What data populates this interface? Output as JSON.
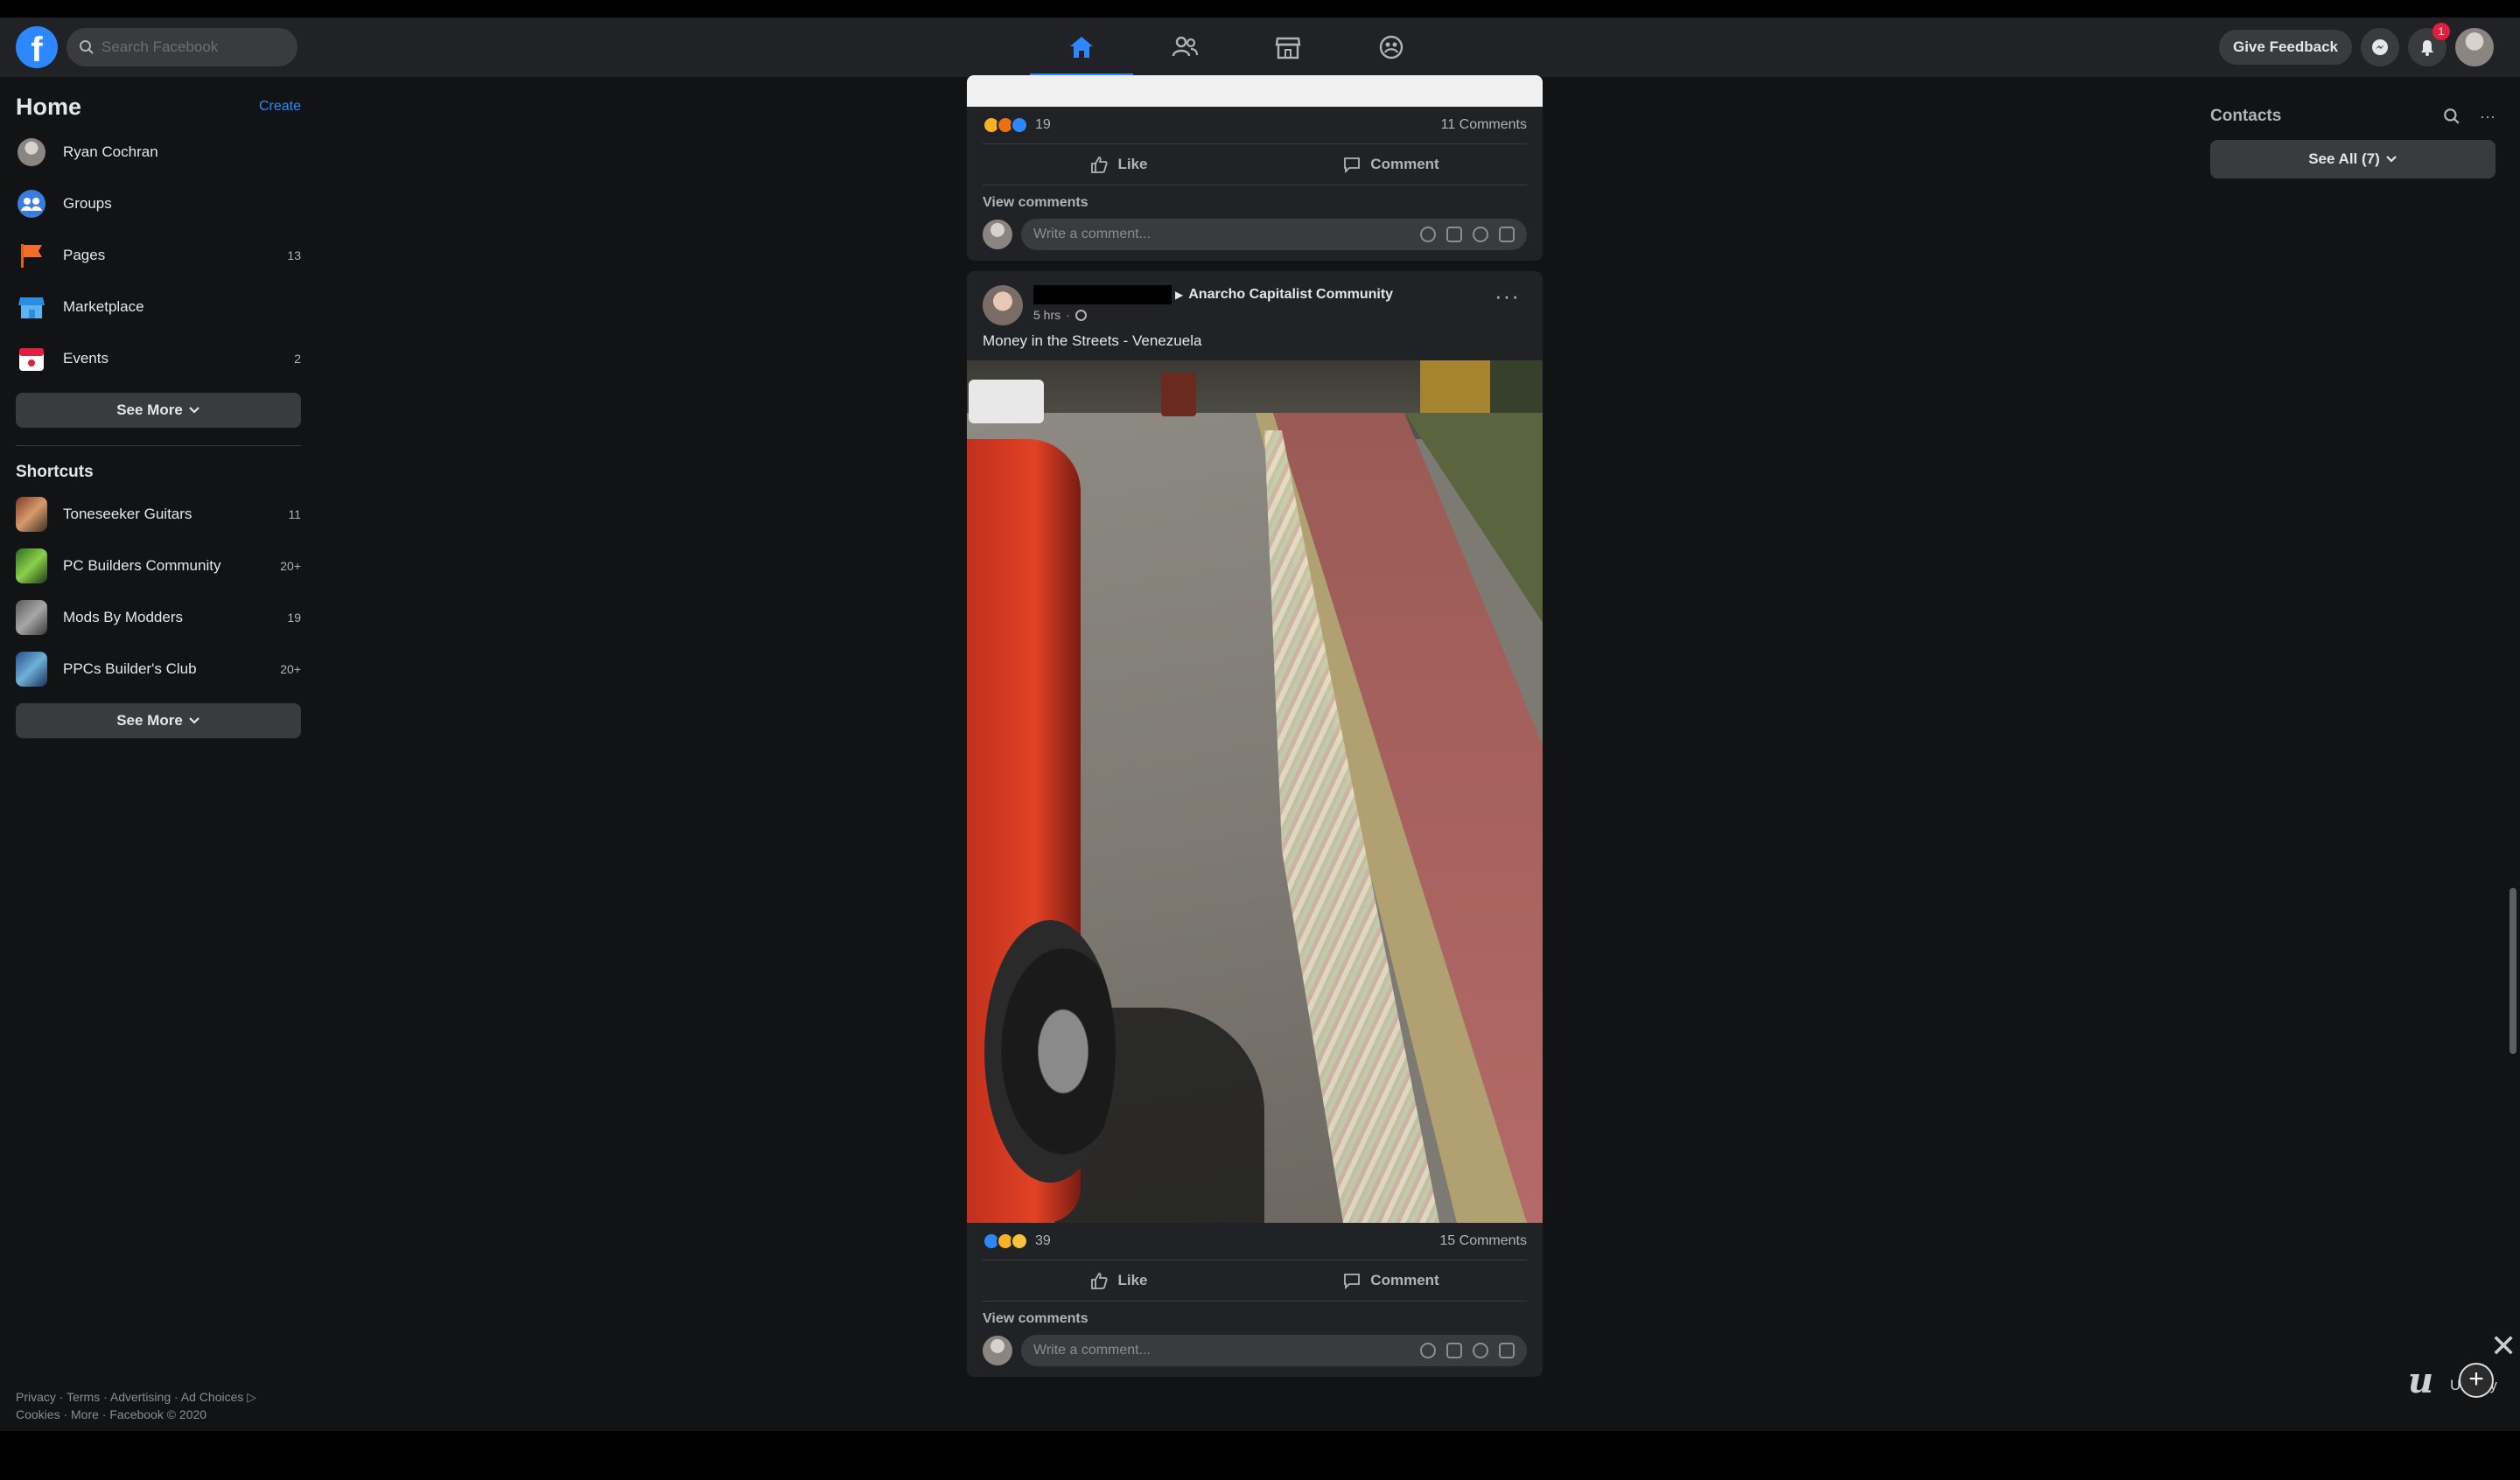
{
  "topbar": {
    "logo_letter": "f",
    "search_placeholder": "Search Facebook",
    "give_feedback": "Give Feedback",
    "notification_count": "1"
  },
  "sidebar": {
    "title": "Home",
    "create": "Create",
    "items": [
      {
        "label": "Ryan Cochran",
        "count": "",
        "icon": "user-avatar"
      },
      {
        "label": "Groups",
        "count": "",
        "icon": "groups-icon"
      },
      {
        "label": "Pages",
        "count": "13",
        "icon": "flag-icon"
      },
      {
        "label": "Marketplace",
        "count": "",
        "icon": "storefront-icon"
      },
      {
        "label": "Events",
        "count": "2",
        "icon": "calendar-icon"
      }
    ],
    "see_more": "See More",
    "shortcuts_title": "Shortcuts",
    "shortcuts": [
      {
        "label": "Toneseeker Guitars",
        "count": "11"
      },
      {
        "label": "PC Builders Community",
        "count": "20+"
      },
      {
        "label": "Mods By Modders",
        "count": "19"
      },
      {
        "label": "PPCs Builder's Club",
        "count": "20+"
      }
    ],
    "see_more_2": "See More",
    "footer_line1": "Privacy · Terms · Advertising · Ad Choices ▷",
    "footer_line2": "Cookies · More · Facebook © 2020"
  },
  "feed": {
    "post1": {
      "reaction_count": "19",
      "comments": "11 Comments",
      "like": "Like",
      "comment": "Comment",
      "view_comments": "View comments",
      "write_placeholder": "Write a comment..."
    },
    "post2": {
      "group": "Anarcho Capitalist Community",
      "time": "5 hrs",
      "text": "Money in the Streets - Venezuela",
      "reaction_count": "39",
      "comments": "15 Comments",
      "like": "Like",
      "comment": "Comment",
      "view_comments": "View comments",
      "write_placeholder": "Write a comment..."
    }
  },
  "contacts": {
    "title": "Contacts",
    "see_all": "See All (7)"
  },
  "watermark": {
    "logo": "u",
    "text": "Udemy"
  },
  "colors": {
    "accent": "#2d88ff",
    "background": "#111315",
    "card": "#202226",
    "button": "#3a3b3c"
  }
}
